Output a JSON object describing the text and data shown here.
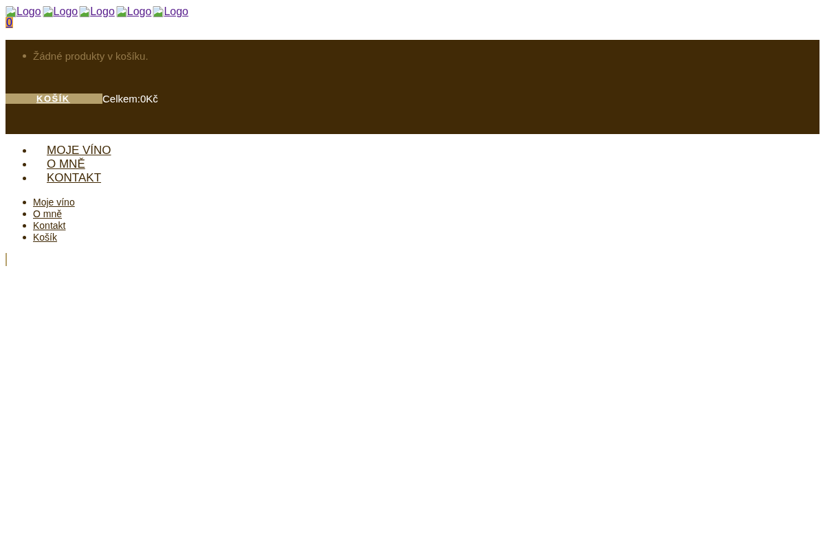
{
  "logos": [
    {
      "label": "Logo"
    },
    {
      "label": "Logo"
    },
    {
      "label": "Logo"
    },
    {
      "label": "Logo"
    },
    {
      "label": "Logo"
    }
  ],
  "cart_count": "0",
  "cart_panel": {
    "items": [
      "Žádné produkty v košíku."
    ],
    "button": "KOŠÍK",
    "total": "Celkem:0Kč"
  },
  "main_menu": [
    {
      "label": "MOJE VÍNO"
    },
    {
      "label": "O MNĚ"
    },
    {
      "label": "KONTAKT"
    }
  ],
  "secondary_menu": [
    {
      "label": "Moje víno"
    },
    {
      "label": "O mně"
    },
    {
      "label": "Kontakt"
    },
    {
      "label": "Košík"
    }
  ]
}
